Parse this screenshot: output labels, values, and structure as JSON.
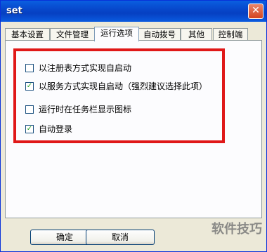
{
  "window": {
    "title": "set",
    "close_glyph": "✕"
  },
  "tabs": [
    {
      "label": "基本设置",
      "active": false
    },
    {
      "label": "文件管理",
      "active": false
    },
    {
      "label": "运行选项",
      "active": true
    },
    {
      "label": "自动拨号",
      "active": false
    },
    {
      "label": "其他",
      "active": false
    },
    {
      "label": "控制端",
      "active": false
    }
  ],
  "options": [
    {
      "label": "以注册表方式实现自启动",
      "checked": false,
      "mark": ""
    },
    {
      "label": "以服务方式实现自启动（强烈建议选择此项）",
      "checked": true,
      "mark": "✓"
    },
    {
      "label": "运行时在任务栏显示图标",
      "checked": false,
      "mark": ""
    },
    {
      "label": "自动登录",
      "checked": true,
      "mark": "✓"
    }
  ],
  "buttons": {
    "ok_label": "确定",
    "cancel_label": "取消"
  },
  "watermark": "软件技巧",
  "colors": {
    "highlight": "#e01818",
    "titlebar": "#0745c9"
  }
}
